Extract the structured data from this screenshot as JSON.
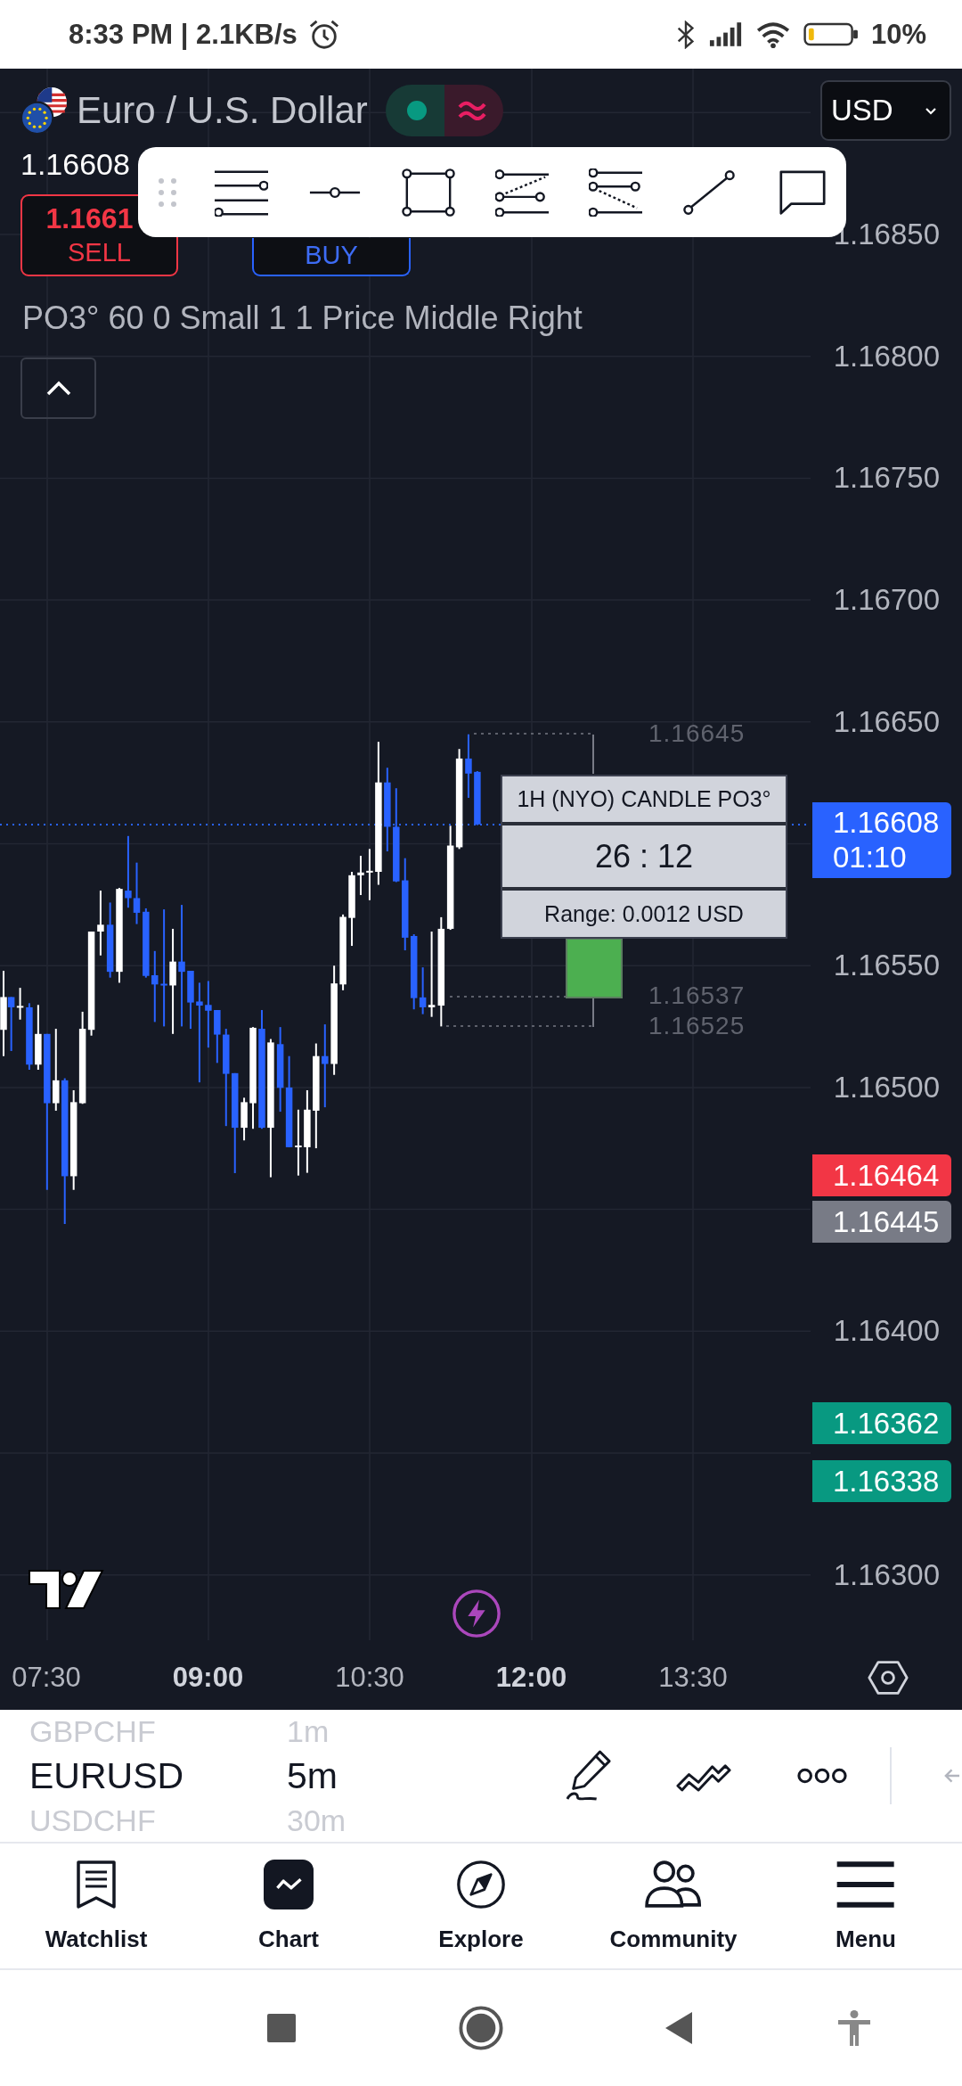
{
  "status_bar": {
    "time_speed": "8:33 PM | 2.1KB/s",
    "battery": "10%"
  },
  "symbol": {
    "title": "Euro / U.S. Dollar",
    "price": "1.16608"
  },
  "currency_dropdown": {
    "value": "USD"
  },
  "sell_button": {
    "price": "1.1661",
    "label": "SELL"
  },
  "buy_button": {
    "label": "BUY"
  },
  "indicator_legend": "PO3° 60 0 Small 1 1 Price Middle Right",
  "price_axis": [
    "1.16850",
    "1.16800",
    "1.16750",
    "1.16700",
    "1.16650",
    "1.16550",
    "1.16500",
    "1.16400",
    "1.16300"
  ],
  "price_tags": [
    {
      "price": "1.16608",
      "countdown": "01:10",
      "color": "#2962ff"
    },
    {
      "price": "1.16464",
      "color": "#f23645"
    },
    {
      "price": "1.16445",
      "color": "#787b86"
    },
    {
      "price": "1.16362",
      "color": "#089981"
    },
    {
      "price": "1.16338",
      "color": "#089981"
    }
  ],
  "candle_panel": {
    "title": "1H (NYO) CANDLE PO3°",
    "timer": "26 : 12",
    "range": "Range: 0.0012 USD"
  },
  "level_labels": [
    "1.16645",
    "1.16537",
    "1.16525"
  ],
  "time_axis": [
    {
      "label": "07:30",
      "emphasized": false
    },
    {
      "label": "09:00",
      "emphasized": true
    },
    {
      "label": "10:30",
      "emphasized": false
    },
    {
      "label": "12:00",
      "emphasized": true
    },
    {
      "label": "13:30",
      "emphasized": false
    }
  ],
  "symbol_picker": [
    {
      "label": "GBPCHF",
      "selected": false
    },
    {
      "label": "EURUSD",
      "selected": true
    },
    {
      "label": "USDCHF",
      "selected": false
    }
  ],
  "interval_picker": [
    {
      "label": "1m",
      "selected": false
    },
    {
      "label": "5m",
      "selected": true
    },
    {
      "label": "30m",
      "selected": false
    }
  ],
  "bottom_nav": [
    {
      "kind": "watchlist",
      "label": "Watchlist",
      "selected": false
    },
    {
      "kind": "chart",
      "label": "Chart",
      "selected": true
    },
    {
      "kind": "explore",
      "label": "Explore",
      "selected": false
    },
    {
      "kind": "community",
      "label": "Community",
      "selected": false
    },
    {
      "kind": "menu",
      "label": "Menu",
      "selected": false
    }
  ]
}
